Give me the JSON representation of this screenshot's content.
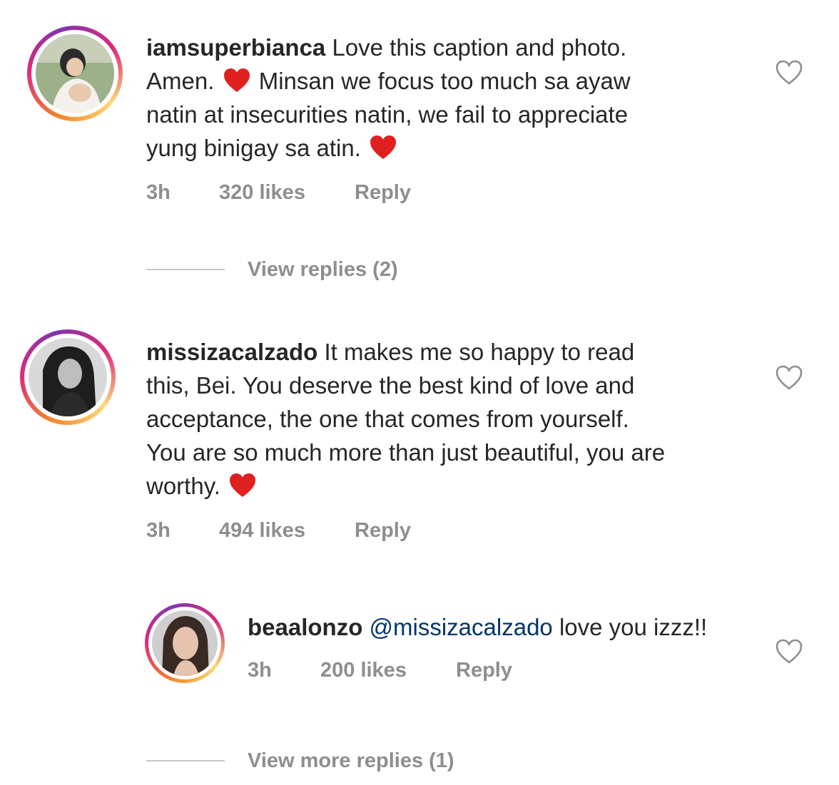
{
  "comments": [
    {
      "username": "iamsuperbianca",
      "lines": [
        "Love this caption and photo.",
        "Amen.",
        "Minsan we focus too much sa ayaw",
        "natin at insecurities  natin, we fail to appreciate",
        "yung binigay sa atin."
      ],
      "time": "3h",
      "likes": "320 likes",
      "reply": "Reply",
      "view_replies": "View replies (2)"
    },
    {
      "username": "missizacalzado",
      "lines": [
        "It makes me so happy to read",
        "this, Bei. You deserve the best kind of love and",
        "acceptance, the one that comes from yourself.",
        "You are so much more than just beautiful, you are",
        "worthy."
      ],
      "time": "3h",
      "likes": "494 likes",
      "reply": "Reply"
    },
    {
      "username": "beaalonzo",
      "mention": "@missizacalzado",
      "text": "love you izzz!!",
      "time": "3h",
      "likes": "200 likes",
      "reply": "Reply",
      "view_replies": "View more replies (1)"
    }
  ],
  "colors": {
    "text": "#262626",
    "meta": "#8e8e8e",
    "mention": "#003569",
    "heart_emoji": "#e0201e"
  },
  "icons": {
    "like": "heart-outline-icon",
    "emoji": "red-heart-emoji"
  }
}
